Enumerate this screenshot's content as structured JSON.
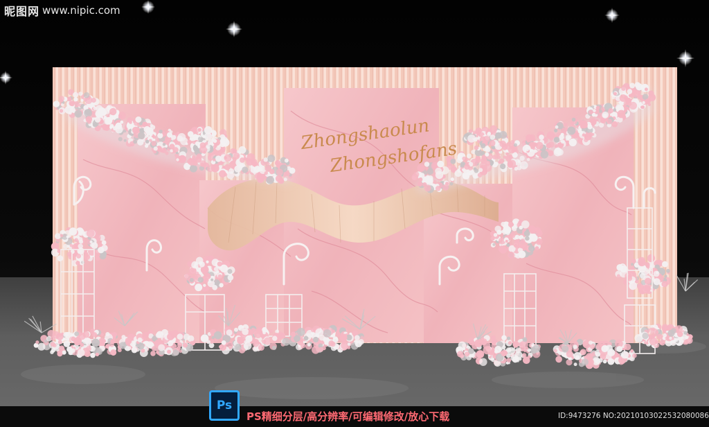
{
  "backdrop": {
    "script_line1": "Zhongshaolun",
    "script_line2": "Zhongshofans"
  },
  "watermark": {
    "site_logo": "昵图网",
    "site_url": "www.nipic.com",
    "ps_badge": "Ps",
    "tagline": "PS精细分层/高分辨率/可编辑修改/放心下载",
    "image_id": "ID:9473276 NO:20210103022532080086"
  },
  "colors": {
    "sky": "#050505",
    "curtain": "#f3cbbd",
    "marble": "#f2b9bf",
    "marble_vein": "#e48f9c",
    "ribbon": "#eed0b4",
    "script_gold": "#c98a4e",
    "floor": "#5a5a5a",
    "flowers_pink": "#f6b8c4",
    "flowers_white": "#f4f1f2",
    "ps_blue": "#31a8ff",
    "tagline_red": "#ff6a73"
  }
}
